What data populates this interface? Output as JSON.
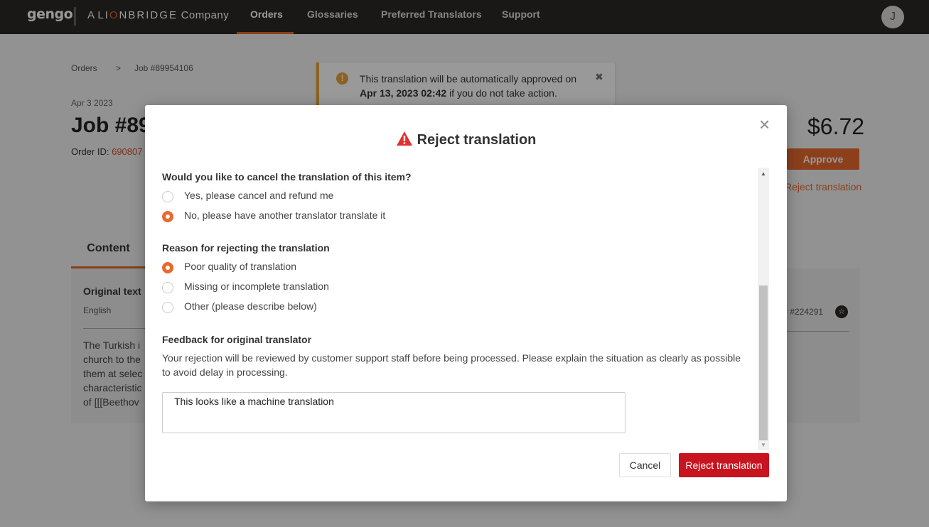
{
  "topnav": {
    "logo": "gengo",
    "brand_prefix": "A",
    "brand_name_1": "LI",
    "brand_name_o": "O",
    "brand_name_2": "NBRIDGE",
    "brand_suffix": "Company",
    "items": [
      {
        "label": "Orders",
        "active": true
      },
      {
        "label": "Glossaries"
      },
      {
        "label": "Preferred Translators"
      },
      {
        "label": "Support"
      }
    ],
    "avatar_initial": "J"
  },
  "breadcrumb": {
    "root": "Orders",
    "separator": ">",
    "current": "Job #89954106"
  },
  "job": {
    "date": "Apr 3 2023",
    "title_visible": "Job #89",
    "order_id_label": "Order ID:",
    "order_id_value": "690807",
    "price": "$6.72",
    "approve_label": "Approve",
    "reject_link": "Reject translation"
  },
  "alert": {
    "line1": "This translation will be automatically approved on",
    "line2_bold": "Apr 13, 2023 02:42",
    "line2_rest": " if you do not take action.",
    "close": "✖",
    "accent": "#e8a33b"
  },
  "content": {
    "tab_label": "Content",
    "original_label": "Original text",
    "original_lang": "English",
    "original_lines": [
      "The Turkish i",
      "church to the",
      "them at selec",
      "characteristic",
      "of [[[Beethov"
    ],
    "translator_id": "r #224291"
  },
  "modal": {
    "title": "Reject translation",
    "close": "×",
    "question1": "Would you like to cancel the translation of this item?",
    "q1_options": [
      {
        "label": "Yes, please cancel and refund me",
        "selected": false
      },
      {
        "label": "No, please have another translator translate it",
        "selected": true
      }
    ],
    "question2": "Reason for rejecting the translation",
    "q2_options": [
      {
        "label": "Poor quality of translation",
        "selected": true
      },
      {
        "label": "Missing or incomplete translation",
        "selected": false
      },
      {
        "label": "Other (please describe below)",
        "selected": false
      }
    ],
    "feedback_label": "Feedback for original translator",
    "feedback_help": "Your rejection will be reviewed by customer support staff before being processed. Please explain the situation as clearly as possible to avoid delay in processing.",
    "feedback_value": "This looks like a machine translation",
    "cancel_label": "Cancel",
    "reject_label": "Reject translation",
    "accent": "#e8692e",
    "danger": "#c8141f"
  }
}
